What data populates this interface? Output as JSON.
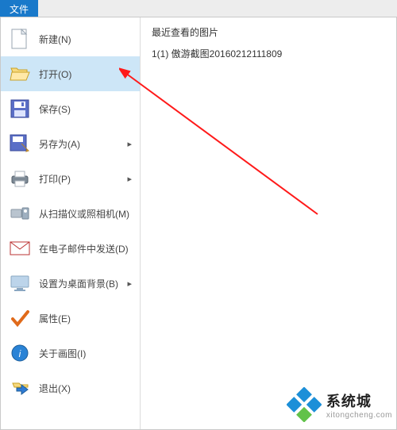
{
  "tab": {
    "label": "文件"
  },
  "menu": {
    "items": [
      {
        "label": "新建(N)",
        "submenu": false
      },
      {
        "label": "打开(O)",
        "submenu": false,
        "highlight": true
      },
      {
        "label": "保存(S)",
        "submenu": false
      },
      {
        "label": "另存为(A)",
        "submenu": true
      },
      {
        "label": "打印(P)",
        "submenu": true
      },
      {
        "label": "从扫描仪或照相机(M)",
        "submenu": false
      },
      {
        "label": "在电子邮件中发送(D)",
        "submenu": false
      },
      {
        "label": "设置为桌面背景(B)",
        "submenu": true
      },
      {
        "label": "属性(E)",
        "submenu": false
      },
      {
        "label": "关于画图(I)",
        "submenu": false
      },
      {
        "label": "退出(X)",
        "submenu": false
      }
    ]
  },
  "panel": {
    "heading": "最近查看的图片",
    "recent": [
      "1(1)  傲游截图20160212111809"
    ]
  },
  "watermark": {
    "brand": "系统城",
    "url": "xitongcheng.com"
  }
}
